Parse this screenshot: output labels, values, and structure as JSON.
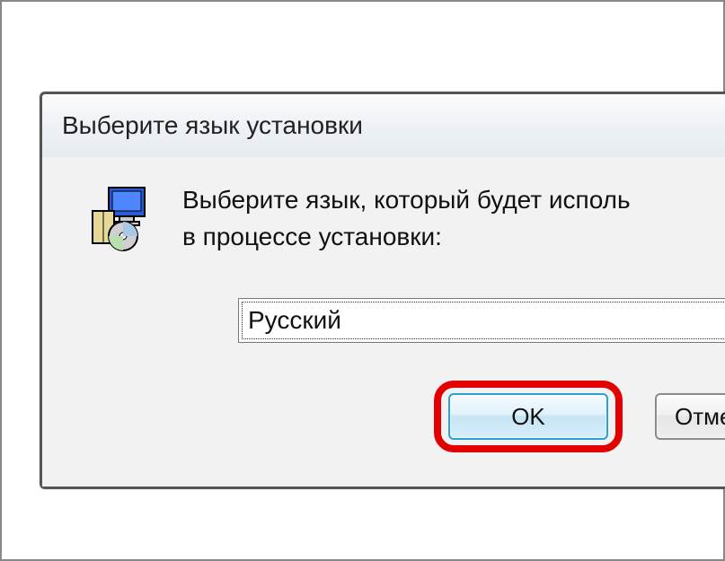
{
  "dialog": {
    "title": "Выберите язык установки",
    "instruction_line1": "Выберите язык, который будет исполь",
    "instruction_line2": "в  процессе установки:",
    "language_select": {
      "value": "Русский"
    },
    "buttons": {
      "ok": "OK",
      "cancel": "Отме"
    }
  }
}
